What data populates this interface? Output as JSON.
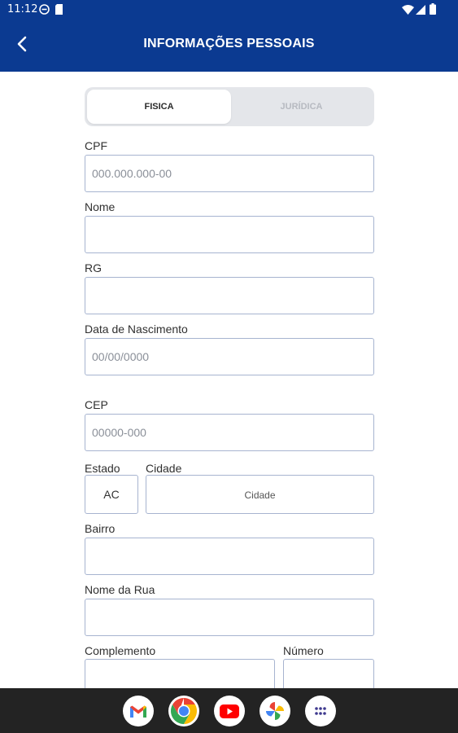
{
  "status_bar": {
    "time": "11:12"
  },
  "header": {
    "title": "INFORMAÇÕES PESSOAIS"
  },
  "segment": {
    "option_fisica": "FISICA",
    "option_juridica": "JURÍDICA"
  },
  "form": {
    "cpf": {
      "label": "CPF",
      "placeholder": "000.000.000-00"
    },
    "nome": {
      "label": "Nome",
      "placeholder": ""
    },
    "rg": {
      "label": "RG",
      "placeholder": ""
    },
    "nascimento": {
      "label": "Data de Nascimento",
      "placeholder": "00/00/0000"
    },
    "cep": {
      "label": "CEP",
      "placeholder": "00000-000"
    },
    "estado": {
      "label": "Estado",
      "placeholder": "AC"
    },
    "cidade": {
      "label": "Cidade",
      "placeholder": "Cidade"
    },
    "bairro": {
      "label": "Bairro",
      "placeholder": ""
    },
    "rua": {
      "label": "Nome da Rua",
      "placeholder": ""
    },
    "complemento": {
      "label": "Complemento",
      "placeholder": ""
    },
    "numero": {
      "label": "Número",
      "placeholder": ""
    }
  },
  "dock": {
    "apps": [
      "gmail-icon",
      "chrome-icon",
      "youtube-icon",
      "photos-icon",
      "app-drawer-icon"
    ]
  },
  "colors": {
    "primary": "#0b3a91",
    "field_border": "#a7b4d0",
    "nav_bar": "#232323"
  }
}
